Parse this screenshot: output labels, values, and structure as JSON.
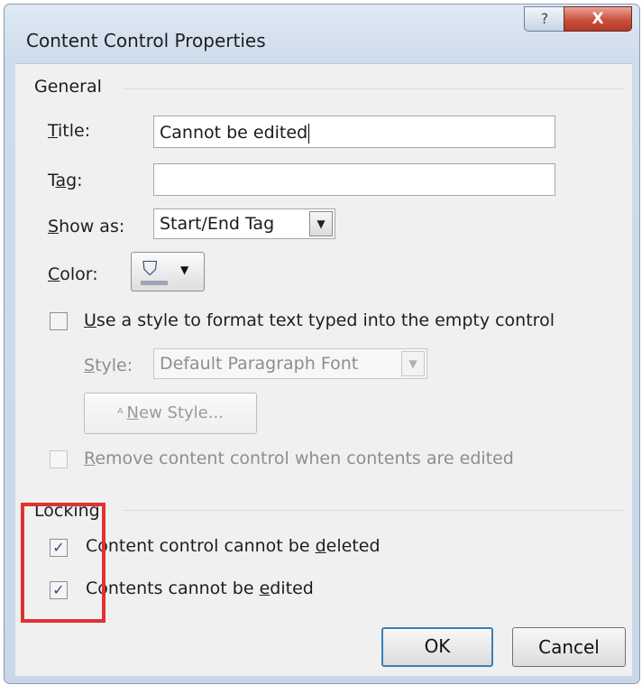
{
  "window": {
    "title": "Content Control Properties",
    "help_icon": "help-icon",
    "help_glyph": "?",
    "close_icon": "close-icon",
    "close_glyph": "X"
  },
  "general": {
    "heading": "General",
    "title_label_u": "T",
    "title_label_rest": "itle:",
    "title_value": "Cannot be edited",
    "tag_label_a": "T",
    "tag_label_u": "a",
    "tag_label_rest": "g:",
    "tag_value": "",
    "showas_label_u": "S",
    "showas_label_rest": "how as:",
    "showas_value": "Start/End Tag",
    "color_label_u": "C",
    "color_label_rest": "olor:",
    "color_icon": "paint-bucket-icon",
    "use_style_u": "U",
    "use_style_rest": "se a style to format text typed into the empty control",
    "use_style_checked": false,
    "style_label_u": "S",
    "style_label_rest": "tyle:",
    "style_value": "Default Paragraph Font",
    "new_style_icon": "new-style-icon",
    "new_style_u": "N",
    "new_style_rest": "ew Style...",
    "remove_u": "R",
    "remove_rest": "emove content control when contents are edited",
    "remove_checked": false
  },
  "locking": {
    "heading": "Locking",
    "cannot_delete_a": "Content control cannot be ",
    "cannot_delete_u": "d",
    "cannot_delete_rest": "eleted",
    "cannot_delete_checked": true,
    "cannot_edit_a": "Contents cannot be ",
    "cannot_edit_u": "e",
    "cannot_edit_rest": "dited",
    "cannot_edit_checked": true
  },
  "buttons": {
    "ok": "OK",
    "cancel": "Cancel"
  },
  "colors": {
    "highlight": "#e0322f",
    "close_button": "#c9503d",
    "default_button_border": "#3c7fb1"
  },
  "checkmark": "✓",
  "dropdown_arrow": "▼"
}
